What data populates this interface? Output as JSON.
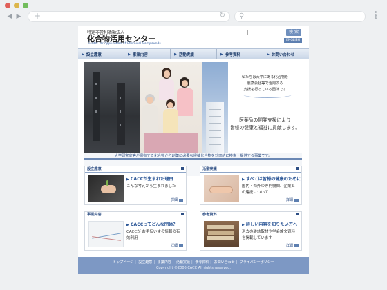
{
  "browser": {
    "url": "",
    "search": ""
  },
  "site": {
    "org_subtitle": "特定非営利活動法人",
    "org_name": "化合物活用センター",
    "org_english": "Center for Application of Chemical Compounds",
    "search_button": "検 索",
    "english_button": "ENGLISH"
  },
  "gnav": [
    {
      "label": "設立趣意"
    },
    {
      "label": "事業内容"
    },
    {
      "label": "活動実績"
    },
    {
      "label": "参考資料"
    },
    {
      "label": "お問い合わせ"
    }
  ],
  "hero": {
    "line1": "私たちは大学にある化合物を",
    "line2": "製薬会社等で活用する",
    "line3": "支援を行っている団体です",
    "line4": "医薬品の開発支援により",
    "line5": "皆様の健康と福祉に貢献します。",
    "caption": "大学研究室等が保有する化合物から創薬に必要な候補化合物を効率的に検索・提供する事業です。"
  },
  "cards": [
    {
      "category": "設立趣意",
      "title": "CACCが生まれた理由",
      "body": "こんな考えから生まれました",
      "more": "詳細"
    },
    {
      "category": "活動実績",
      "title": "すべては皆様の健康のために",
      "body": "国内・海外の専門機関、企業との連携について",
      "more": "詳細"
    },
    {
      "category": "事業内容",
      "title": "CACCってどんな団体？",
      "body": "CACCが お手伝いする情報の有効利用",
      "more": "詳細"
    },
    {
      "category": "参考資料",
      "title": "詳しい内容を知りたい方へ",
      "body": "過去の雑誌取材や学会論文資料を掲載しています",
      "more": "詳細"
    }
  ],
  "footer": {
    "links": [
      "トップページ",
      "設立趣意",
      "事業内容",
      "活動実績",
      "参考資料",
      "お問い合わせ",
      "プライバシーポリシー"
    ],
    "copyright": "Copyright ©2006 CACC All rights reserved."
  }
}
